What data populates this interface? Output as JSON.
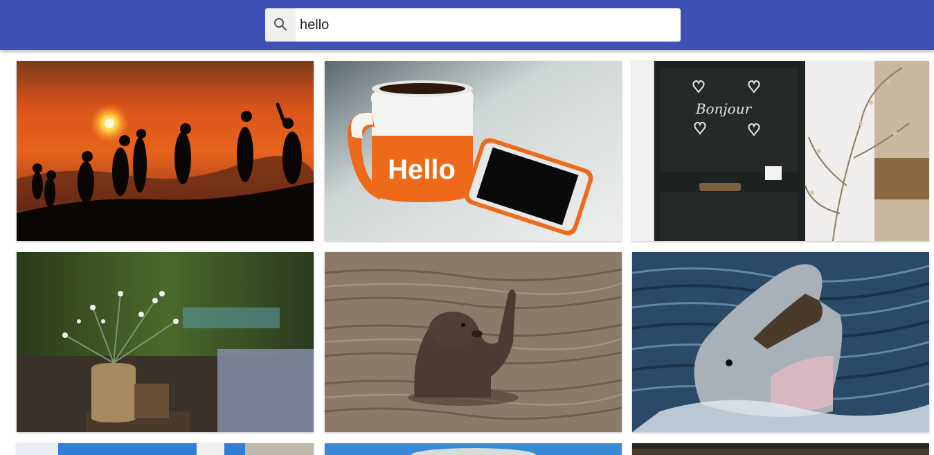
{
  "search": {
    "value": "hello",
    "icon": "search-icon"
  },
  "colors": {
    "app_bar": "#3f51b5",
    "background": "#ffffff"
  },
  "results": [
    {
      "subject": "hikers-silhouette-sunset",
      "text": ""
    },
    {
      "subject": "hello-mug-and-phone",
      "text": "Hello"
    },
    {
      "subject": "chalkboard-door",
      "text": "Bonjour"
    },
    {
      "subject": "flower-vase",
      "text": ""
    },
    {
      "subject": "waving-seal",
      "text": ""
    },
    {
      "subject": "smiling-dolphin",
      "text": ""
    },
    {
      "subject": "partial-row-image-1",
      "text": ""
    },
    {
      "subject": "partial-row-image-2",
      "text": ""
    },
    {
      "subject": "partial-row-image-3",
      "text": ""
    }
  ]
}
